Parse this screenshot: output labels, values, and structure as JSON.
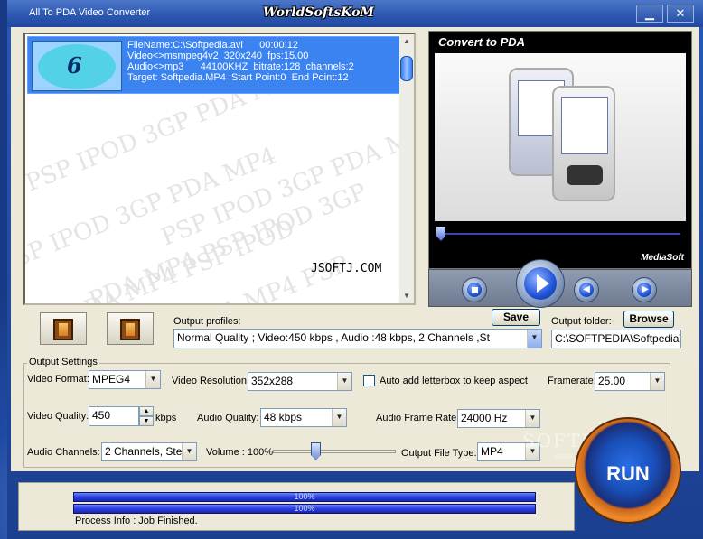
{
  "window": {
    "title": "All To PDA Video Converter",
    "logo_text": "WorldSoftsKoM",
    "minimize_glyph": "▁",
    "close_glyph": "✕"
  },
  "file_list": {
    "watermark_rows": [
      "PSP IPOD 3GP PDA MP4",
      "PSP IPOD 3GP PDA MP4",
      "PSP IPOD 3GP PDA MP4",
      "PDA MP4 PSP IPOD 3GP",
      "3GP PDA MP4 PSP IPOD",
      "IPOD 3GP PDA MP4 PSP"
    ],
    "items": [
      {
        "thumbnail_label": "6",
        "line1": "FileName:C:\\Softpedia.avi      00:00:12",
        "line2": "Video<>msmpeg4v2  320x240  fps:15.00",
        "line3": "Audio<>mp3      44100KHZ  bitrate:128  channels:2",
        "line4": "Target: Softpedia.MP4 ;Start Point:0  End Point:12"
      }
    ],
    "overlay_text": "JSOFTJ.COM"
  },
  "preview": {
    "heading": "Convert to PDA",
    "brand": "MediaSoft",
    "seek_position": 0.02
  },
  "controls": {
    "stop_icon": "stop-icon",
    "play_icon": "play-icon",
    "prev_icon": "rewind-icon",
    "next_icon": "forward-icon"
  },
  "output": {
    "profiles_label": "Output profiles:",
    "profile_value": "Normal Quality ; Video:450 kbps , Audio :48 kbps,  2 Channels ,St",
    "save_label": "Save",
    "folder_label": "Output folder:",
    "browse_label": "Browse",
    "folder_value": "C:\\SOFTPEDIA\\SoftpediaTe"
  },
  "settings": {
    "group_title": "Output Settings",
    "video_format_label": "Video Format:",
    "video_format": "MPEG4",
    "video_resolution_label": "Video Resolution:",
    "video_resolution": "352x288",
    "letterbox_label": "Auto add letterbox to keep aspect",
    "letterbox_checked": false,
    "framerate_label": "Framerate:",
    "framerate": "25.00",
    "video_quality_label": "Video Quality:",
    "video_quality": "450",
    "video_quality_unit": "kbps",
    "audio_quality_label": "Audio Quality:",
    "audio_quality": "48 kbps",
    "audio_frame_rate_label": "Audio Frame Rate:",
    "audio_frame_rate": "24000 Hz",
    "audio_channels_label": "Audio Channels:",
    "audio_channels": "2 Channels, Stere",
    "volume_label": "Volume : 100%",
    "volume_level": 1.0,
    "output_file_type_label": "Output File Type:",
    "output_file_type": "MP4"
  },
  "run": {
    "label": "RUN"
  },
  "watermark": {
    "text": "SOFTPEDIA",
    "url": "www.softpedia.com"
  },
  "status": {
    "progress1_text": "100%",
    "progress2_text": "100%",
    "progress1": 1.0,
    "progress2": 1.0,
    "info": "Process Info :  Job Finished."
  }
}
